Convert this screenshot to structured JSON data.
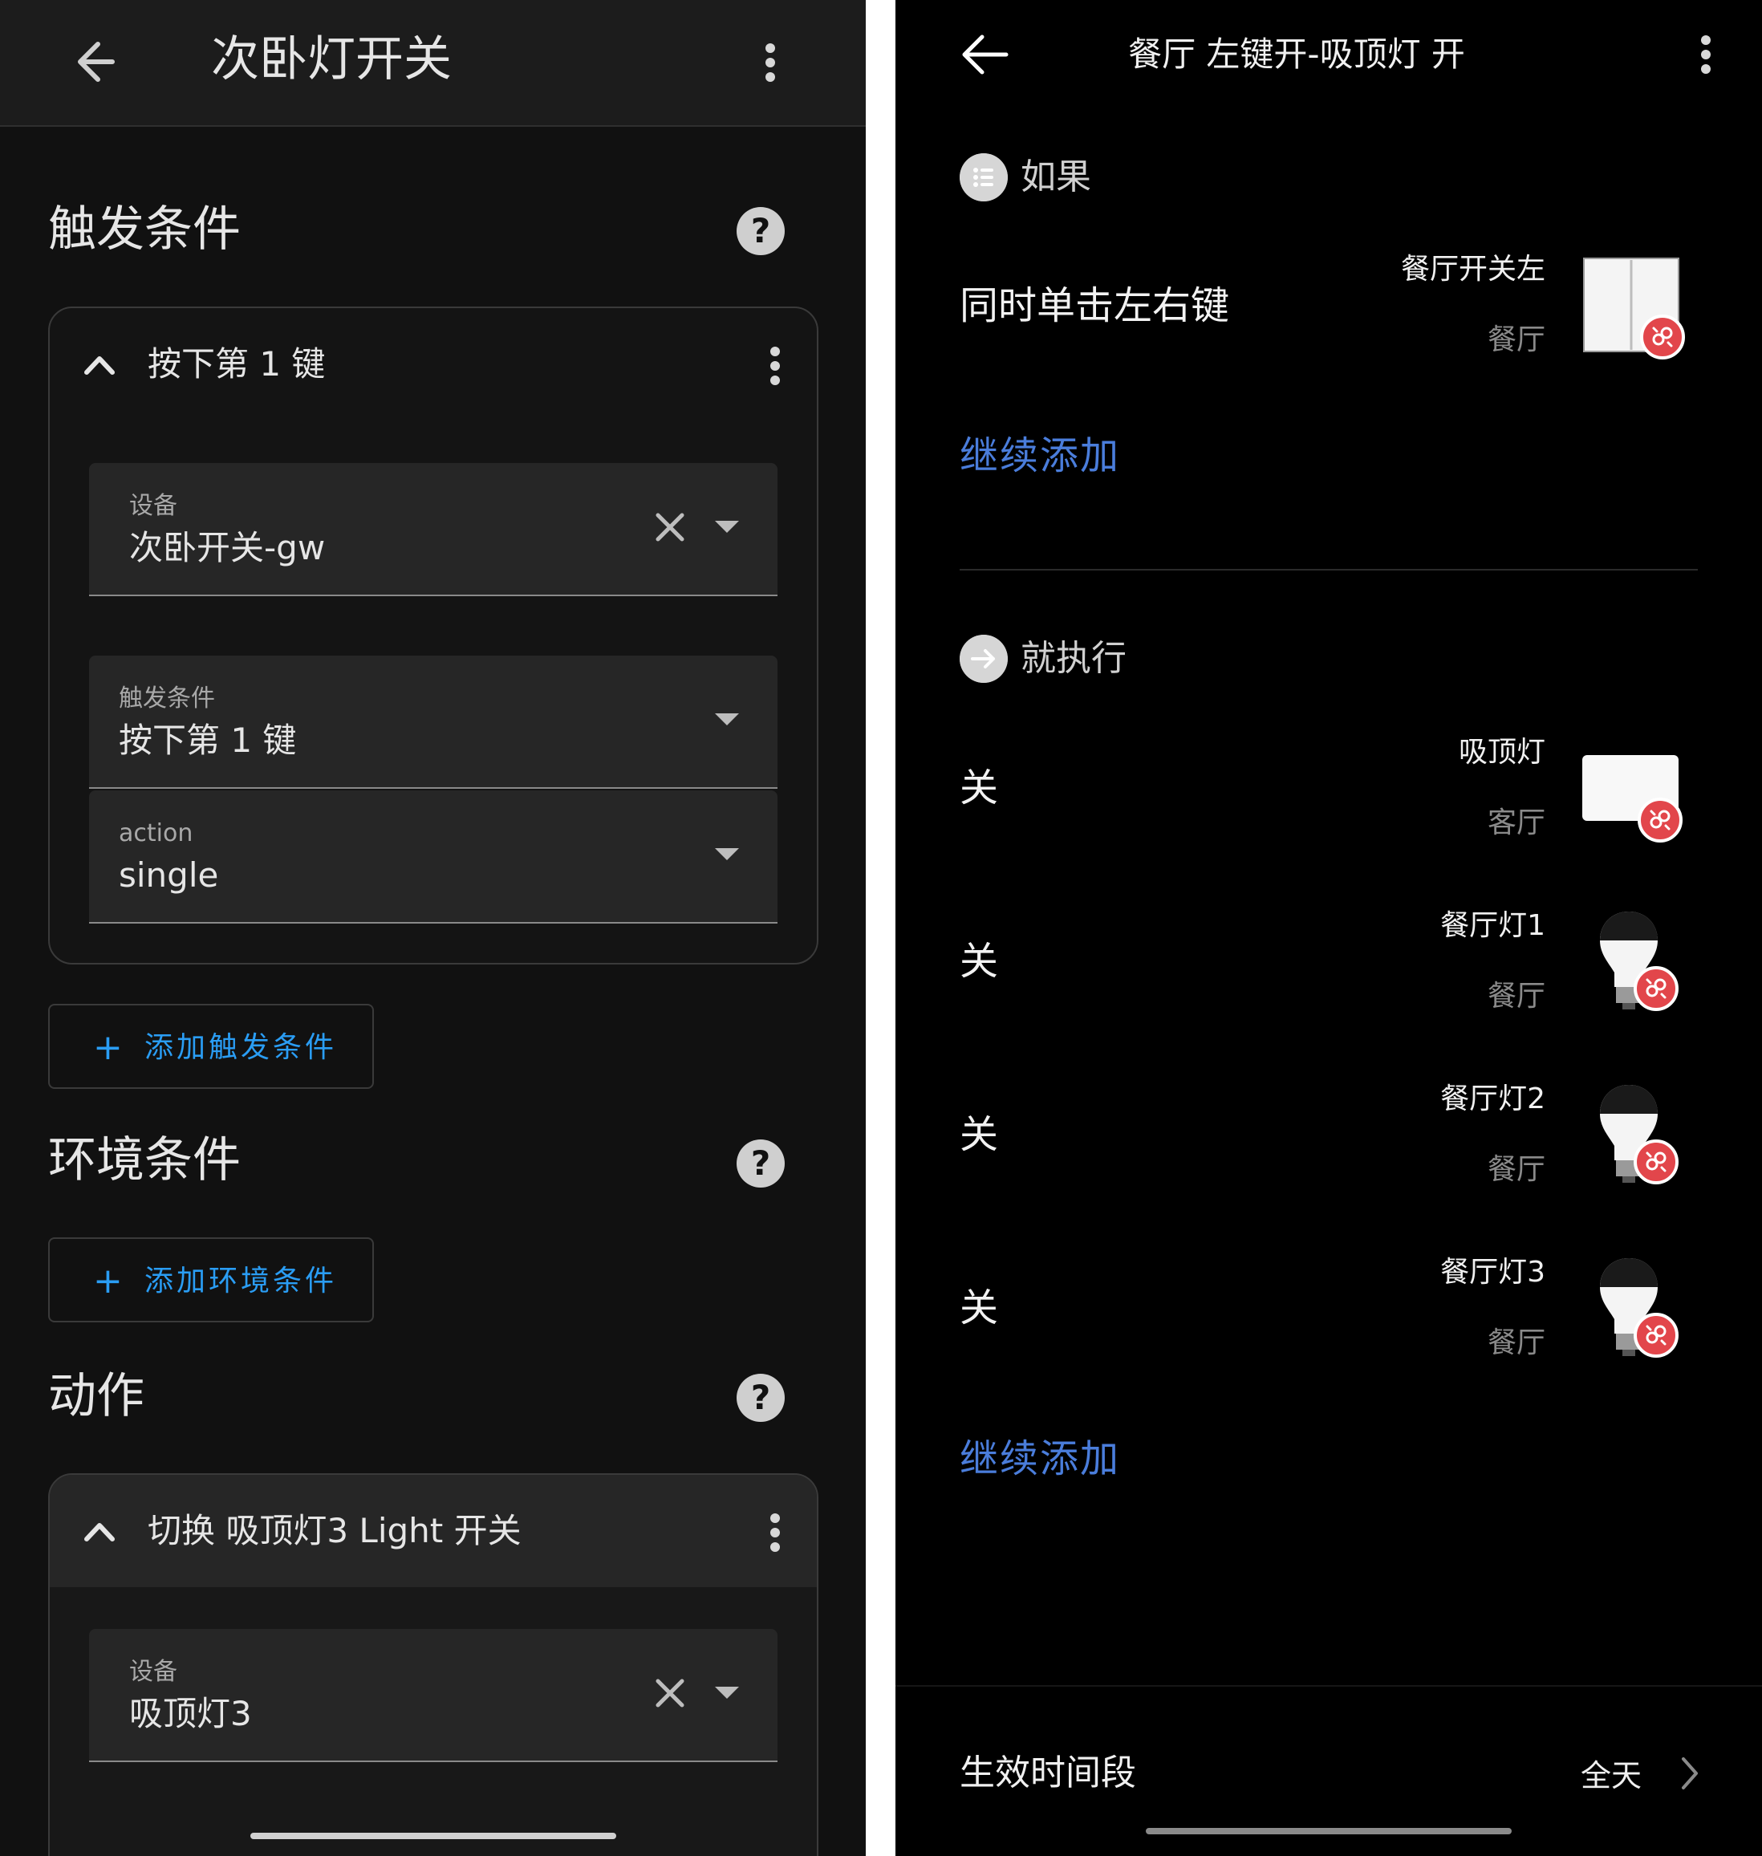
{
  "left": {
    "title": "次卧灯开关",
    "sections": {
      "triggers": "触发条件",
      "conditions": "环境条件",
      "actions": "动作"
    },
    "trigger_card": {
      "title": "按下第 1 键",
      "device_label": "设备",
      "device_value": "次卧开关-gw",
      "trigger_label": "触发条件",
      "trigger_value": "按下第 1 键",
      "action_label": "action",
      "action_value": "single"
    },
    "add_trigger": "添加触发条件",
    "add_condition": "添加环境条件",
    "action_card": {
      "title": "切换 吸顶灯3 Light 开关",
      "device_label": "设备",
      "device_value": "吸顶灯3"
    },
    "icons": [
      "back-arrow-icon",
      "more-vert-icon",
      "help-icon",
      "chevron-up-icon",
      "close-icon",
      "dropdown-icon",
      "plus-icon"
    ],
    "colors": {
      "accent": "#2a9df4",
      "background": "#111111"
    }
  },
  "right": {
    "title": "餐厅 左键开-吸顶灯 开",
    "if_label": "如果",
    "if_row": {
      "action": "同时单击左右键",
      "device": "餐厅开关左",
      "room": "餐厅"
    },
    "add_more": "继续添加",
    "then_label": "就执行",
    "actions": [
      {
        "action": "关",
        "device": "吸顶灯",
        "room": "客厅"
      },
      {
        "action": "关",
        "device": "餐厅灯1",
        "room": "餐厅"
      },
      {
        "action": "关",
        "device": "餐厅灯2",
        "room": "餐厅"
      },
      {
        "action": "关",
        "device": "餐厅灯3",
        "room": "餐厅"
      }
    ],
    "add_more_2": "继续添加",
    "effective_time_label": "生效时间段",
    "effective_time_value": "全天",
    "icons": [
      "back-arrow-icon",
      "more-vert-icon",
      "list-icon",
      "arrow-right-circle-icon",
      "switch-device-icon",
      "ceiling-light-icon",
      "bulb-icon",
      "unlinked-badge-icon",
      "chevron-right-icon"
    ],
    "colors": {
      "link": "#4a7ddb",
      "badge": "#e2464b",
      "background": "#000000"
    }
  }
}
